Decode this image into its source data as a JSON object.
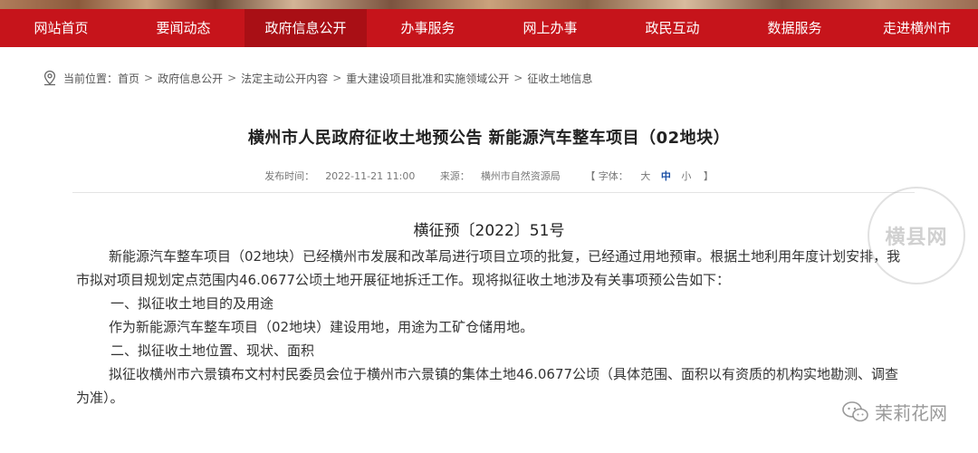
{
  "nav": {
    "items": [
      {
        "label": "网站首页"
      },
      {
        "label": "要闻动态"
      },
      {
        "label": "政府信息公开"
      },
      {
        "label": "办事服务"
      },
      {
        "label": "网上办事"
      },
      {
        "label": "政民互动"
      },
      {
        "label": "数据服务"
      },
      {
        "label": "走进横州市"
      }
    ],
    "active_index": 2,
    "bg_color": "#c6141b"
  },
  "breadcrumb": {
    "prefix": "当前位置：",
    "items": [
      "首页",
      "政府信息公开",
      "法定主动公开内容",
      "重大建设项目批准和实施领域公开",
      "征收土地信息"
    ],
    "separator": ">"
  },
  "article": {
    "title": "横州市人民政府征收土地预公告 新能源汽车整车项目（02地块）",
    "meta": {
      "publish_label": "发布时间：",
      "publish_time": "2022-11-21 11:00",
      "source_label": "来源：",
      "source": "横州市自然资源局",
      "font_label": "【 字体：",
      "size_large": "大",
      "size_medium": "中",
      "size_small": "小",
      "font_close": "】"
    },
    "doc_number": "横征预〔2022〕51号",
    "paragraphs": {
      "p1": "新能源汽车整车项目（02地块）已经横州市发展和改革局进行项目立项的批复，已经通过用地预审。根据土地利用年度计划安排，我市拟对项目规划定点范围内46.0677公顷土地开展征地拆迁工作。现将拟征收土地涉及有关事项预公告如下：",
      "h1": "一、拟征收土地目的及用途",
      "p2": "作为新能源汽车整车项目（02地块）建设用地，用途为工矿仓储用地。",
      "h2": "二、拟征收土地位置、现状、面积",
      "p3": "拟征收横州市六景镇布文村村民委员会位于横州市六景镇的集体土地46.0677公顷（具体范围、面积以有资质的机构实地勘测、调查为准）。"
    }
  },
  "watermarks": {
    "seal_text": "横县网",
    "footer_text": "茉莉花网"
  }
}
